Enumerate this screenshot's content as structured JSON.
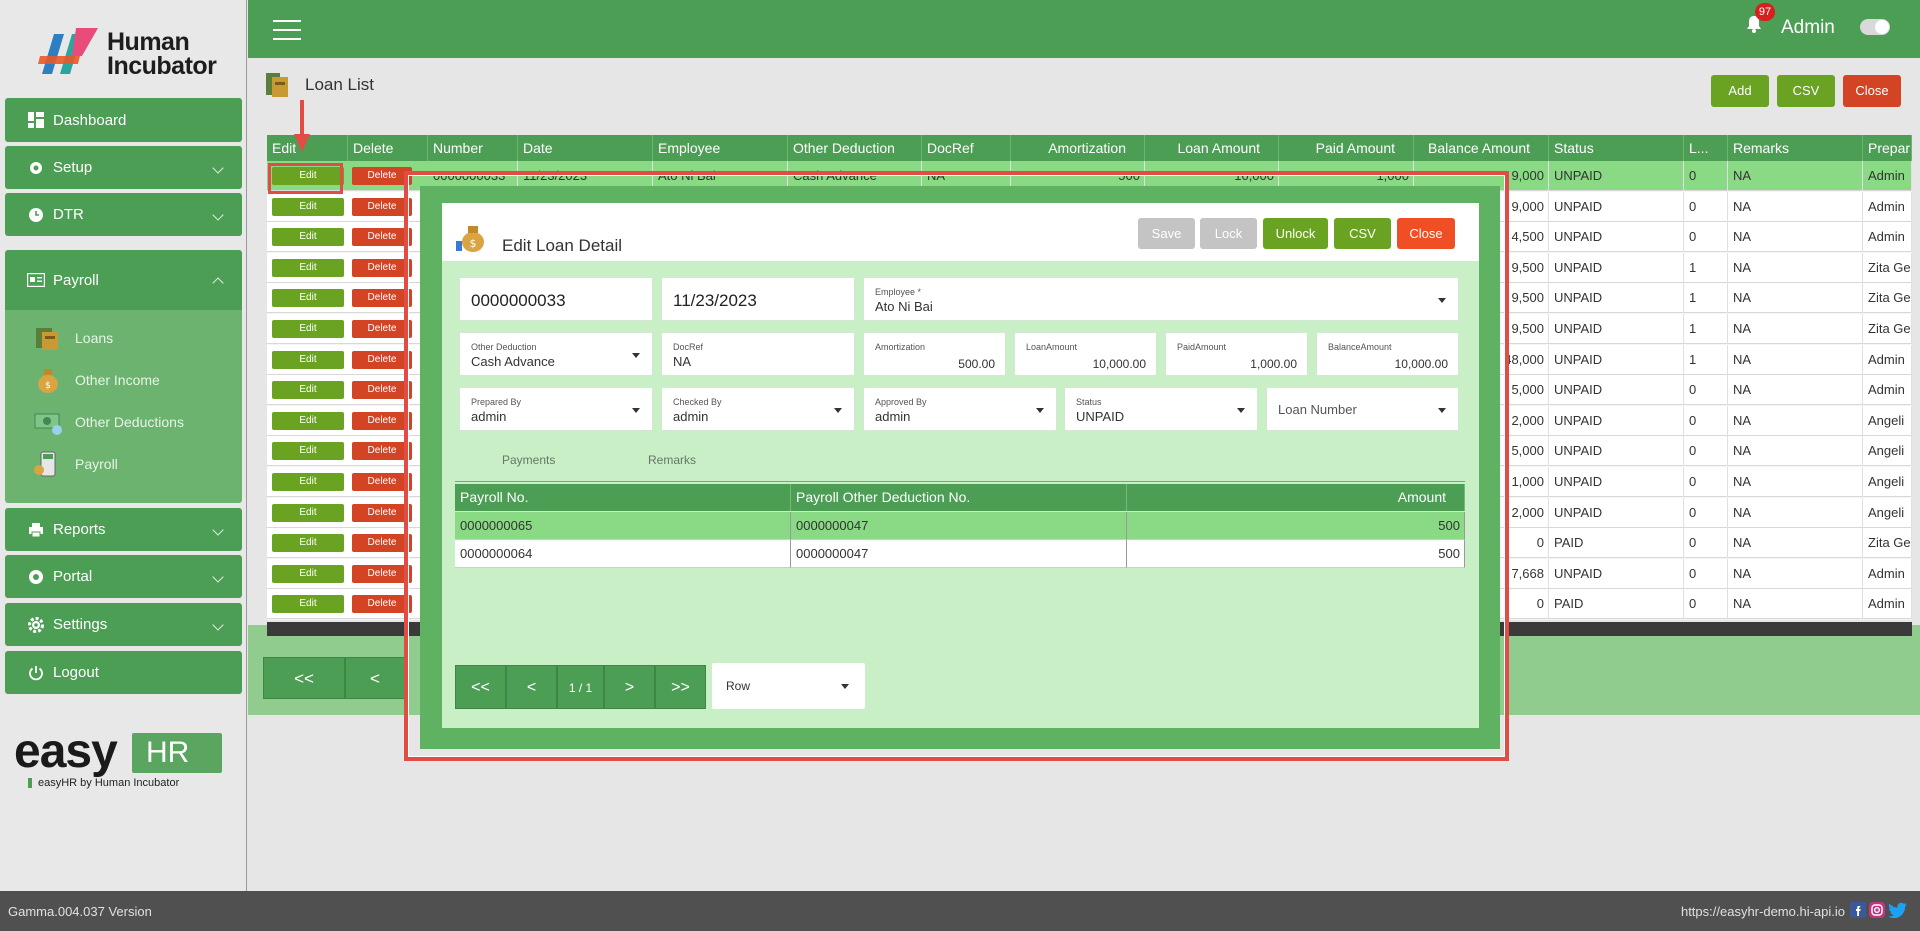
{
  "brand": {
    "logo_text_1": "Human",
    "logo_text_2": "Incubator",
    "easy": "easy",
    "hr": "HR",
    "byline": "easyHR by Human Incubator"
  },
  "sidebar": {
    "items": [
      {
        "label": "Dashboard",
        "icon": "dashboard-icon"
      },
      {
        "label": "Setup",
        "icon": "wrench-icon"
      },
      {
        "label": "DTR",
        "icon": "clock-icon"
      },
      {
        "label": "Payroll",
        "icon": "payroll-icon"
      },
      {
        "label": "Reports",
        "icon": "printer-icon"
      },
      {
        "label": "Portal",
        "icon": "aperture-icon"
      },
      {
        "label": "Settings",
        "icon": "gear-icon"
      },
      {
        "label": "Logout",
        "icon": "power-icon"
      }
    ],
    "payroll_sub": [
      {
        "label": "Loans"
      },
      {
        "label": "Other Income"
      },
      {
        "label": "Other Deductions"
      },
      {
        "label": "Payroll"
      }
    ]
  },
  "topbar": {
    "notifications": "97",
    "user": "Admin"
  },
  "page": {
    "title": "Loan List",
    "add": "Add",
    "csv": "CSV",
    "close": "Close"
  },
  "table": {
    "headers": [
      "Edit",
      "Delete",
      "Number",
      "Date",
      "Employee",
      "Other Deduction",
      "DocRef",
      "Amortization",
      "Loan Amount",
      "Paid Amount",
      "Balance Amount",
      "Status",
      "L...",
      "Remarks",
      "Prepar"
    ],
    "edit_label": "Edit",
    "delete_label": "Delete",
    "first_row": {
      "number": "0000000033",
      "date": "11/23/2023",
      "employee": "Ato Ni Bai",
      "other_deduction": "Cash Advance",
      "docref": "NA",
      "amortization": "500",
      "loan_amount": "10,000",
      "paid_amount": "1,000"
    },
    "rows": [
      {
        "balance": "9,000",
        "status": "UNPAID",
        "l": "0",
        "remarks": "NA",
        "prepared": "Admin"
      },
      {
        "balance": "9,000",
        "status": "UNPAID",
        "l": "0",
        "remarks": "NA",
        "prepared": "Admin"
      },
      {
        "balance": "4,500",
        "status": "UNPAID",
        "l": "0",
        "remarks": "NA",
        "prepared": "Admin"
      },
      {
        "balance": "9,500",
        "status": "UNPAID",
        "l": "1",
        "remarks": "NA",
        "prepared": "Zita Ge"
      },
      {
        "balance": "9,500",
        "status": "UNPAID",
        "l": "1",
        "remarks": "NA",
        "prepared": "Zita Ge"
      },
      {
        "balance": "9,500",
        "status": "UNPAID",
        "l": "1",
        "remarks": "NA",
        "prepared": "Zita Ge"
      },
      {
        "balance": "48,000",
        "status": "UNPAID",
        "l": "1",
        "remarks": "NA",
        "prepared": "Admin"
      },
      {
        "balance": "5,000",
        "status": "UNPAID",
        "l": "0",
        "remarks": "NA",
        "prepared": "Admin"
      },
      {
        "balance": "2,000",
        "status": "UNPAID",
        "l": "0",
        "remarks": "NA",
        "prepared": "Angeli"
      },
      {
        "balance": "5,000",
        "status": "UNPAID",
        "l": "0",
        "remarks": "NA",
        "prepared": "Angeli"
      },
      {
        "balance": "1,000",
        "status": "UNPAID",
        "l": "0",
        "remarks": "NA",
        "prepared": "Angeli"
      },
      {
        "balance": "2,000",
        "status": "UNPAID",
        "l": "0",
        "remarks": "NA",
        "prepared": "Angeli"
      },
      {
        "balance": "0",
        "status": "PAID",
        "l": "0",
        "remarks": "NA",
        "prepared": "Zita Ge"
      },
      {
        "balance": "7,668",
        "status": "UNPAID",
        "l": "0",
        "remarks": "NA",
        "prepared": "Admin"
      },
      {
        "balance": "0",
        "status": "PAID",
        "l": "0",
        "remarks": "NA",
        "prepared": "Admin"
      }
    ]
  },
  "pager": {
    "first": "<<",
    "prev": "<"
  },
  "modal": {
    "title": "Edit Loan Detail",
    "buttons": {
      "save": "Save",
      "lock": "Lock",
      "unlock": "Unlock",
      "csv": "CSV",
      "close": "Close"
    },
    "number": "0000000033",
    "date": "11/23/2023",
    "employee_label": "Employee *",
    "employee": "Ato Ni Bai",
    "other_deduction_label": "Other Deduction",
    "other_deduction": "Cash Advance",
    "docref_label": "DocRef",
    "docref": "NA",
    "amortization_label": "Amortization",
    "amortization": "500.00",
    "loan_amount_label": "LoanAmount",
    "loan_amount": "10,000.00",
    "paid_amount_label": "PaidAmount",
    "paid_amount": "1,000.00",
    "balance_amount_label": "BalanceAmount",
    "balance_amount": "10,000.00",
    "prepared_by_label": "Prepared By",
    "prepared_by": "admin",
    "checked_by_label": "Checked By",
    "checked_by": "admin",
    "approved_by_label": "Approved By",
    "approved_by": "admin",
    "status_label": "Status",
    "status": "UNPAID",
    "loan_number_placeholder": "Loan Number",
    "tabs": [
      "Payments",
      "Remarks"
    ],
    "sub_headers": [
      "Payroll No.",
      "Payroll Other Deduction No.",
      "Amount"
    ],
    "sub_rows": [
      {
        "payroll_no": "0000000065",
        "deduction_no": "0000000047",
        "amount": "500"
      },
      {
        "payroll_no": "0000000064",
        "deduction_no": "0000000047",
        "amount": "500"
      }
    ],
    "pager": {
      "first": "<<",
      "prev": "<",
      "page": "1 / 1",
      "next": ">",
      "last": ">>"
    },
    "row_select": "Row"
  },
  "footer": {
    "version": "Gamma.004.037 Version",
    "url": "https://easyhr-demo.hi-api.io"
  },
  "colors": {
    "green": "#4d9e55",
    "red": "#d24424",
    "olive": "#6aa322",
    "annotation": "#e34b45"
  }
}
